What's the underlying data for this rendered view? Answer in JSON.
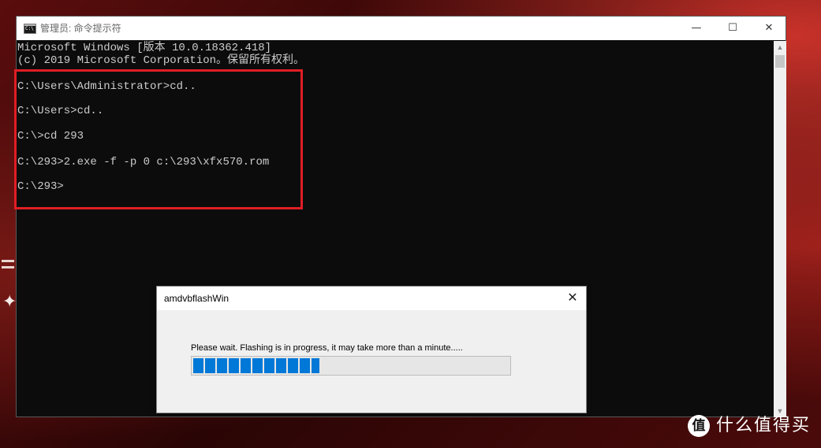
{
  "window": {
    "title": "管理员: 命令提示符",
    "buttons": {
      "minimize": "—",
      "maximize": "☐",
      "close": "✕"
    }
  },
  "console": {
    "lines": [
      "Microsoft Windows [版本 10.0.18362.418]",
      "(c) 2019 Microsoft Corporation。保留所有权利。",
      "C:\\Users\\Administrator>cd..",
      "C:\\Users>cd..",
      "C:\\>cd 293",
      "C:\\293>2.exe -f -p 0 c:\\293\\xfx570.rom",
      "C:\\293>"
    ]
  },
  "scrollbar": {
    "up_icon": "▲",
    "down_icon": "▼"
  },
  "highlight": {
    "color": "#e01e24"
  },
  "dialog": {
    "title": "amdvbflashWin",
    "close": "✕",
    "message": "Please wait.  Flashing is in progress, it may take more than a minute.....",
    "progress_fraction": 0.4,
    "progress_color": "#0078d7"
  },
  "watermark": {
    "logo": "值",
    "text": "什么值得买"
  }
}
